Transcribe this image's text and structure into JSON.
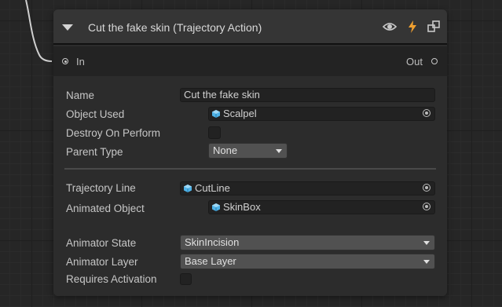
{
  "node": {
    "title": "Cut the fake skin (Trajectory Action)",
    "header_icons": [
      "eye-icon",
      "lightning-icon",
      "link-node-icon"
    ],
    "ports": {
      "in_label": "In",
      "out_label": "Out"
    }
  },
  "fields": {
    "name": {
      "label": "Name",
      "value": "Cut the fake skin"
    },
    "object_used": {
      "label": "Object Used",
      "value": "Scalpel",
      "icon": "cube-icon"
    },
    "destroy_on_perform": {
      "label": "Destroy On Perform",
      "checked": false
    },
    "parent_type": {
      "label": "Parent Type",
      "value": "None"
    },
    "trajectory_line": {
      "label": "Trajectory Line",
      "value": "CutLine",
      "icon": "cube-icon"
    },
    "animated_object": {
      "label": "Animated Object",
      "value": "SkinBox",
      "icon": "cube-icon"
    },
    "animator_state": {
      "label": "Animator State",
      "value": "SkinIncision"
    },
    "animator_layer": {
      "label": "Animator Layer",
      "value": "Base Layer"
    },
    "requires_activation": {
      "label": "Requires Activation",
      "checked": false
    }
  },
  "colors": {
    "background": "#262626",
    "node_body": "#2c2c2c",
    "header": "#353535",
    "lightning_accent": "#f0a030",
    "cube_accent": "#4fb3e8"
  }
}
